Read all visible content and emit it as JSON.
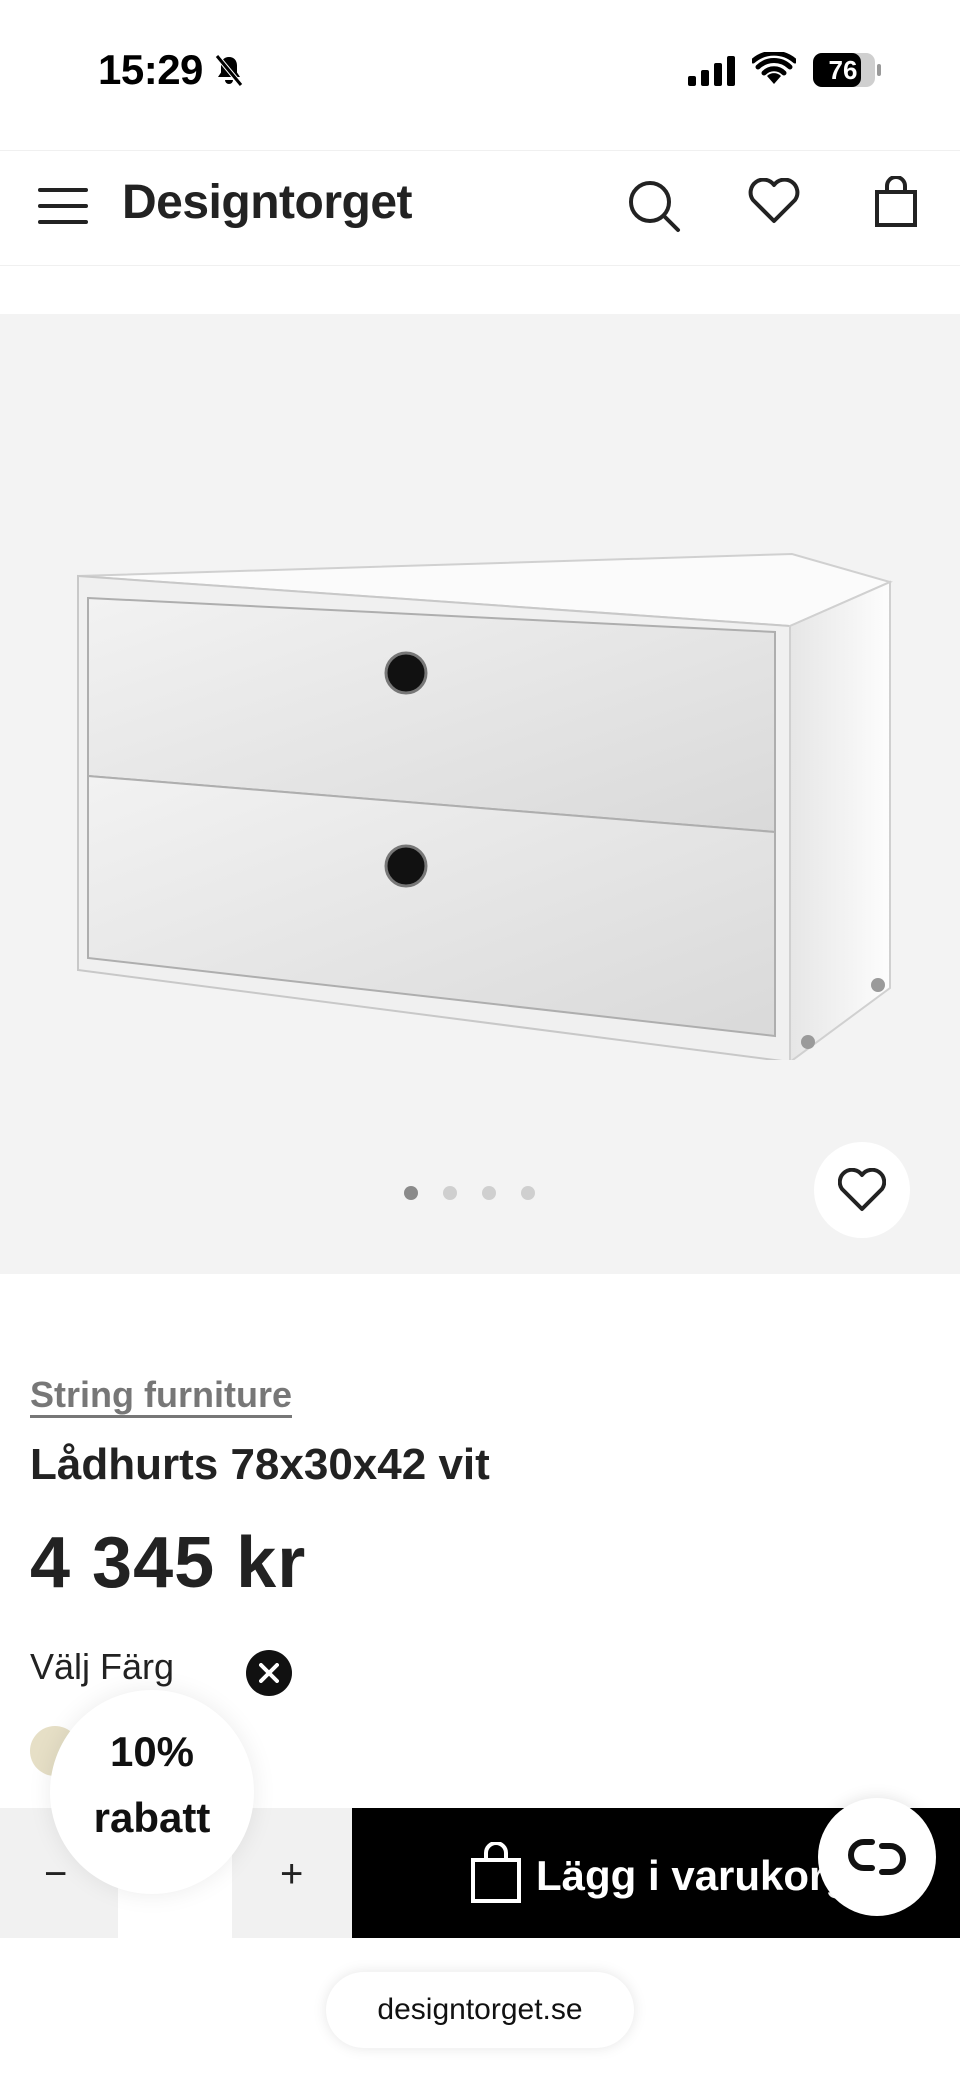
{
  "status_bar": {
    "time": "15:29",
    "battery": "76"
  },
  "header": {
    "brand": "Designtorget"
  },
  "gallery": {
    "image_count": 4,
    "active_index": 0
  },
  "product": {
    "brand": "String furniture",
    "name": "Lådhurts 78x30x42 vit",
    "price": "4 345 kr",
    "color_label": "Välj Färg",
    "swatch_color": "#e6dfc6"
  },
  "promo": {
    "line1": "10%",
    "line2": "rabatt"
  },
  "cart": {
    "minus": "−",
    "plus": "+",
    "button_label": "Lägg i varukorgen"
  },
  "browser": {
    "url": "designtorget.se"
  },
  "colors": {
    "accent": "#000000",
    "gallery_bg": "#f3f3f3",
    "brand_link": "#777777"
  }
}
